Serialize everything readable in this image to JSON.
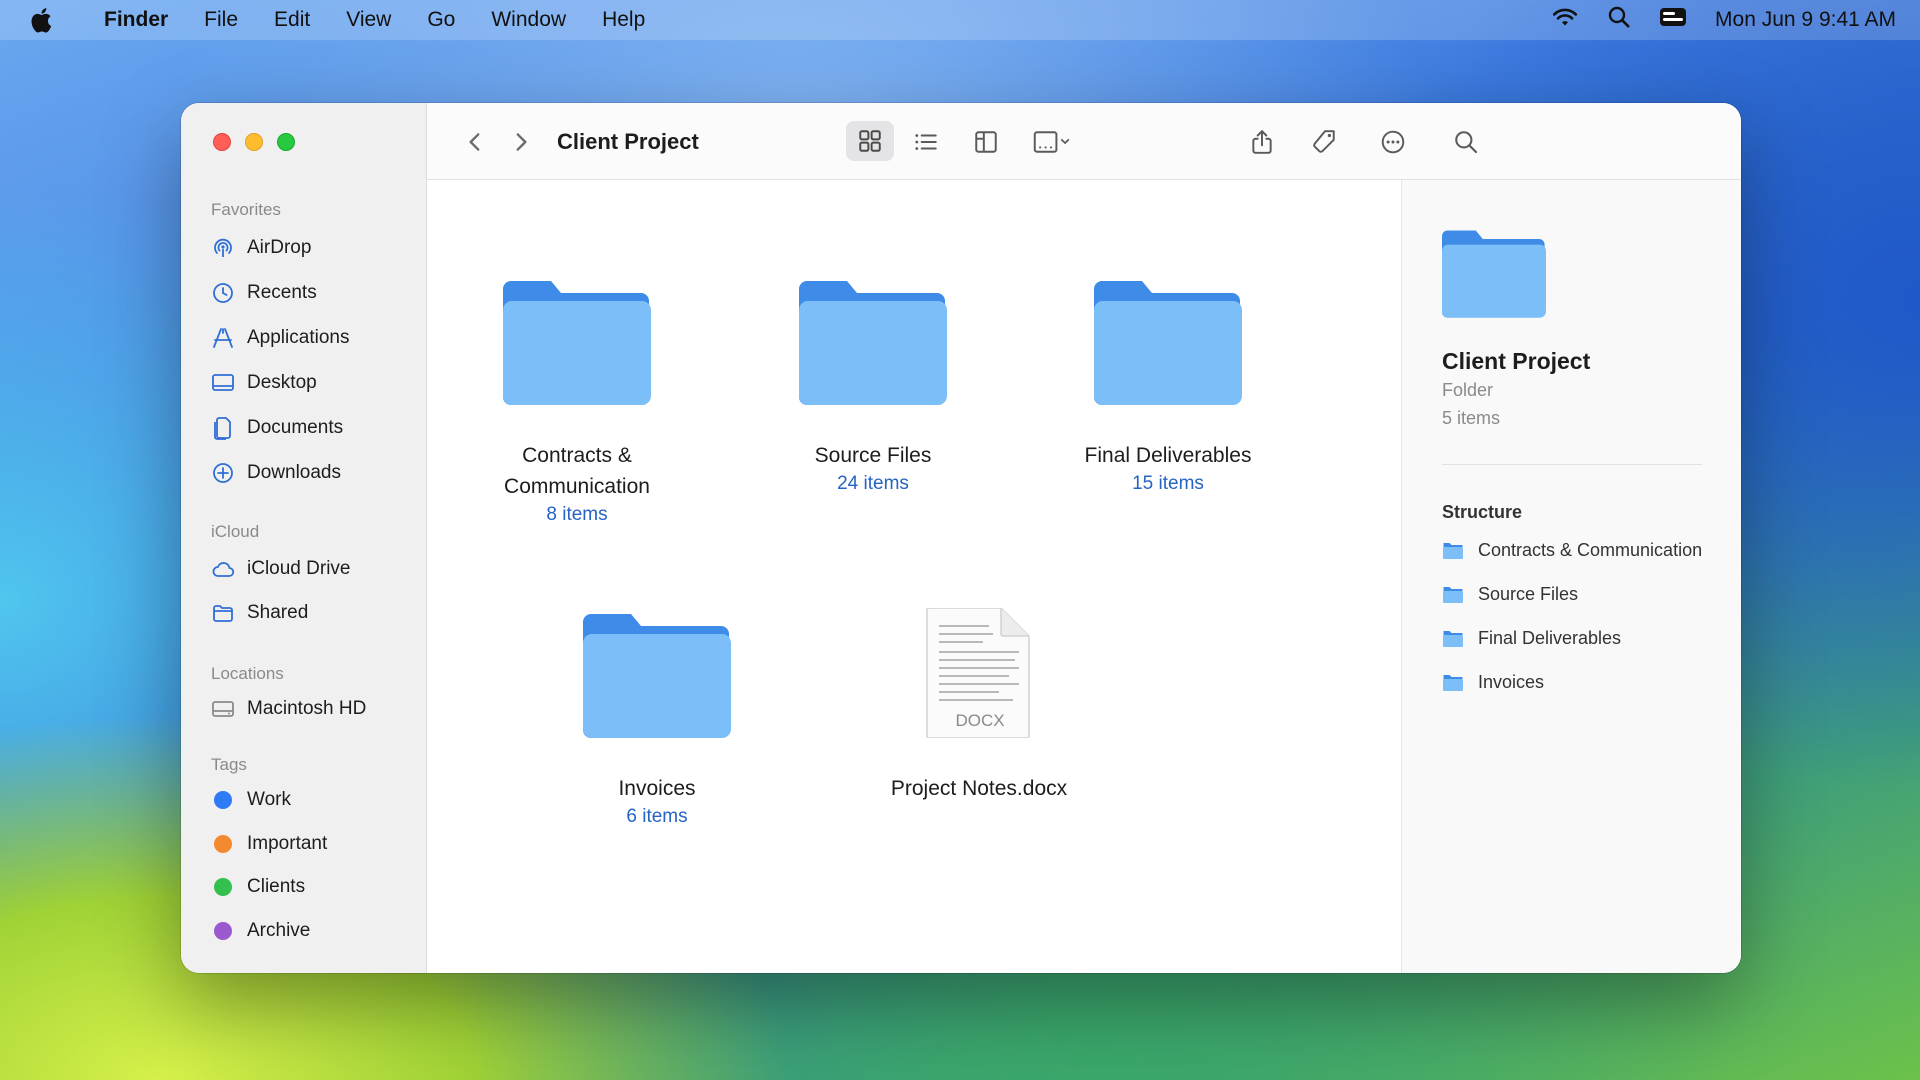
{
  "menubar": {
    "app_name": "Finder",
    "menus": [
      "File",
      "Edit",
      "View",
      "Go",
      "Window",
      "Help"
    ],
    "clock": "Mon Jun 9  9:41 AM"
  },
  "window": {
    "title": "Client Project"
  },
  "sidebar": {
    "favorites_label": "Favorites",
    "favorites": [
      {
        "label": "AirDrop",
        "icon": "airdrop-icon"
      },
      {
        "label": "Recents",
        "icon": "clock-icon"
      },
      {
        "label": "Applications",
        "icon": "applications-icon"
      },
      {
        "label": "Desktop",
        "icon": "desktop-icon"
      },
      {
        "label": "Documents",
        "icon": "document-icon"
      },
      {
        "label": "Downloads",
        "icon": "download-icon"
      }
    ],
    "icloud_label": "iCloud",
    "icloud": [
      {
        "label": "iCloud Drive",
        "icon": "cloud-icon"
      },
      {
        "label": "Shared",
        "icon": "shared-folder-icon"
      }
    ],
    "locations_label": "Locations",
    "locations": [
      {
        "label": "Macintosh HD",
        "icon": "disk-icon"
      }
    ],
    "tags_label": "Tags",
    "tags": [
      {
        "label": "Work",
        "color": "#2f7bf5"
      },
      {
        "label": "Important",
        "color": "#f5892f"
      },
      {
        "label": "Clients",
        "color": "#34c04f"
      },
      {
        "label": "Archive",
        "color": "#9b59d0"
      }
    ]
  },
  "items": [
    {
      "name_line1": "Contracts &",
      "name_line2": "Communication",
      "count": "8 items"
    },
    {
      "name_line1": "Source Files",
      "count": "24 items"
    },
    {
      "name_line1": "Final Deliverables",
      "count": "15 items"
    },
    {
      "name_line1": "Invoices",
      "count": "6 items"
    },
    {
      "name_line1": "Project Notes.docx",
      "file_badge": "DOCX"
    }
  ],
  "preview": {
    "title": "Client Project",
    "kind": "Folder",
    "count": "5 items",
    "structure_label": "Structure",
    "structure": [
      "Contracts & Communication",
      "Source Files",
      "Final Deliverables",
      "Invoices"
    ]
  },
  "colors": {
    "folder_back": "#3f8be8",
    "folder_front": "#7cbff8",
    "link_blue": "#2563c4"
  }
}
